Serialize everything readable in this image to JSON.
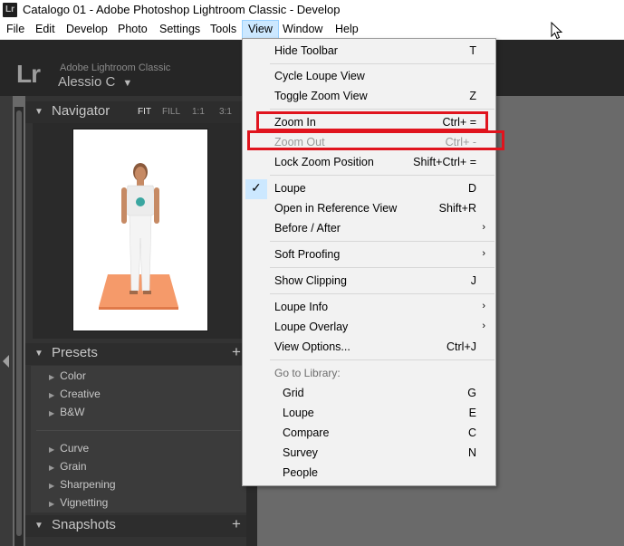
{
  "window": {
    "title": "Catalogo 01 - Adobe Photoshop Lightroom Classic - Develop",
    "app_icon": "Lr"
  },
  "menubar": {
    "items": [
      {
        "label": "File"
      },
      {
        "label": "Edit"
      },
      {
        "label": "Develop"
      },
      {
        "label": "Photo"
      },
      {
        "label": "Settings"
      },
      {
        "label": "Tools"
      },
      {
        "label": "View",
        "active": true
      },
      {
        "label": "Window"
      },
      {
        "label": "Help"
      }
    ]
  },
  "lr_header": {
    "logo": "Lr",
    "app_name": "Adobe Lightroom Classic",
    "user": "Alessio C",
    "user_caret": "▼"
  },
  "navigator": {
    "title": "Navigator",
    "options": [
      "FIT",
      "FILL",
      "1:1",
      "3:1"
    ],
    "selected_option": "FIT"
  },
  "presets": {
    "title": "Presets",
    "add": "+",
    "groups": [
      "Color",
      "Creative",
      "B&W"
    ],
    "groups2": [
      "Curve",
      "Grain",
      "Sharpening",
      "Vignetting"
    ]
  },
  "snapshots": {
    "title": "Snapshots",
    "add": "+"
  },
  "view_menu": {
    "items": [
      {
        "label": "Hide Toolbar",
        "shortcut": "T"
      },
      {
        "label": "Cycle Loupe View",
        "shortcut": ""
      },
      {
        "label": "Toggle Zoom View",
        "shortcut": "Z"
      },
      {
        "label": "Zoom In",
        "shortcut": "Ctrl+ ="
      },
      {
        "label": "Zoom Out",
        "shortcut": "Ctrl+ -",
        "disabled": true
      },
      {
        "label": "Lock Zoom Position",
        "shortcut": "Shift+Ctrl+ ="
      },
      {
        "label": "Loupe",
        "shortcut": "D",
        "checked": true
      },
      {
        "label": "Open in Reference View",
        "shortcut": "Shift+R"
      },
      {
        "label": "Before / After",
        "submenu": true
      },
      {
        "label": "Soft Proofing",
        "submenu": true
      },
      {
        "label": "Show Clipping",
        "shortcut": "J"
      },
      {
        "label": "Loupe Info",
        "submenu": true
      },
      {
        "label": "Loupe Overlay",
        "submenu": true
      },
      {
        "label": "View Options...",
        "shortcut": "Ctrl+J"
      },
      {
        "label": "Go to Library:",
        "section": true
      },
      {
        "label": "Grid",
        "shortcut": "G"
      },
      {
        "label": "Loupe",
        "shortcut": "E"
      },
      {
        "label": "Compare",
        "shortcut": "C"
      },
      {
        "label": "Survey",
        "shortcut": "N"
      },
      {
        "label": "People",
        "shortcut": ""
      }
    ],
    "submenu_arrow": "›",
    "check_mark": "✓"
  },
  "colors": {
    "highlight_box": "#e0141e",
    "menu_active": "#cce8ff",
    "lr_panel": "#333333"
  }
}
